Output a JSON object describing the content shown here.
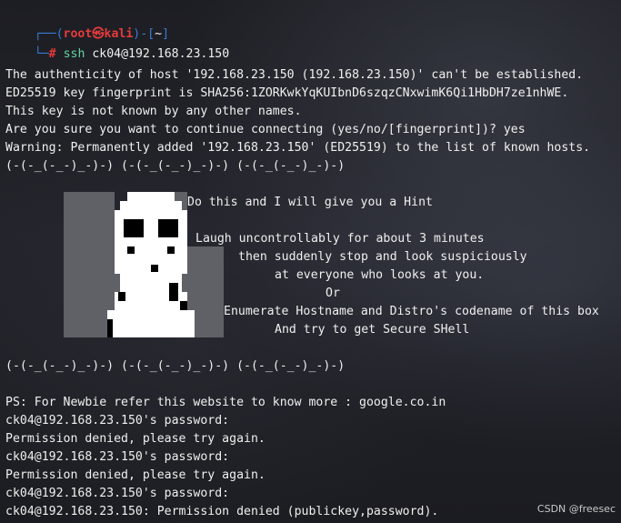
{
  "prompt": {
    "corner_top": "┌──",
    "open": "(",
    "user": "root",
    "at": "㉿",
    "host": "kali",
    "close": ")",
    "dash": "-",
    "dir_open": "[",
    "dir": "~",
    "dir_close": "]",
    "corner_bottom": "└─",
    "hash": "#",
    "cmd_name": "ssh",
    "cmd_args": " ck04@192.168.23.150"
  },
  "output_lines": [
    "The authenticity of host '192.168.23.150 (192.168.23.150)' can't be established.",
    "ED25519 key fingerprint is SHA256:1ZORKwkYqKUIbnD6szqzCNxwimK6Qi1HbDH7ze1nhWE.",
    "This key is not known by any other names.",
    "Are you sure you want to continue connecting (yes/no/[fingerprint])? yes",
    "Warning: Permanently added '192.168.23.150' (ED25519) to the list of known hosts.",
    "(-(-_(-_-)_-)-) (-(-_(-_-)_-)-) (-(-_(-_-)_-)-)"
  ],
  "banner": {
    "hint": "Do this and I will give you a Hint",
    "laugh": "Laugh uncontrollably for about 3 minutes",
    "stop": "then suddenly stop and look suspiciously",
    "everyone": "at everyone who looks at you.",
    "or": "Or",
    "enumerate": "Enumerate Hostname and Distro's codename of this box",
    "try": "And try to get Secure SHell"
  },
  "after_lines": [
    "(-(-_(-_-)_-)-) (-(-_(-_-)_-)-) (-(-_(-_-)_-)-)",
    "PS: For Newbie refer this website to know more : google.co.in",
    "ck04@192.168.23.150's password:",
    "Permission denied, please try again.",
    "ck04@192.168.23.150's password:",
    "Permission denied, please try again.",
    "ck04@192.168.23.150's password:",
    "ck04@192.168.23.150: Permission denied (publickey,password)."
  ],
  "watermark": "CSDN @freesec",
  "colors": {
    "background": "#1f2025",
    "prompt_frame": "#3a7bd5",
    "prompt_user_host": "#e63b3b",
    "command_name": "#62d2a2",
    "text": "#f0f0f0",
    "art_gray": "#5f6166",
    "art_white": "#ffffff",
    "art_black": "#000000"
  }
}
